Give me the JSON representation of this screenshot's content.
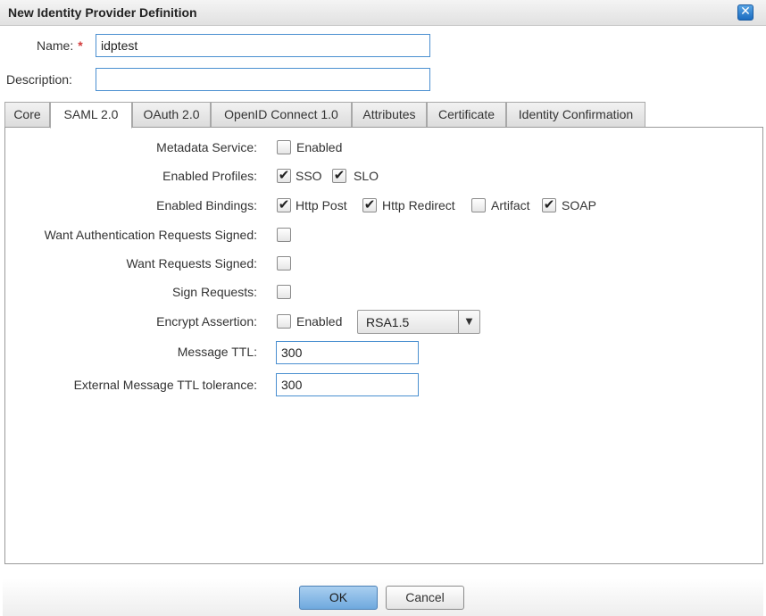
{
  "dialog": {
    "title": "New Identity Provider Definition",
    "close_glyph": "✕"
  },
  "form": {
    "name_label": "Name:",
    "name_required": "*",
    "name_value": "idptest",
    "description_label": "Description:",
    "description_value": ""
  },
  "tabs": [
    {
      "label": "Core",
      "active": false
    },
    {
      "label": "SAML 2.0",
      "active": true
    },
    {
      "label": "OAuth 2.0",
      "active": false
    },
    {
      "label": "OpenID Connect 1.0",
      "active": false
    },
    {
      "label": "Attributes",
      "active": false
    },
    {
      "label": "Certificate",
      "active": false
    },
    {
      "label": "Identity Confirmation",
      "active": false
    }
  ],
  "saml": {
    "metadata_service": {
      "label": "Metadata Service:",
      "option": "Enabled",
      "checked": false
    },
    "enabled_profiles": {
      "label": "Enabled Profiles:",
      "sso": "SSO",
      "sso_checked": true,
      "slo": "SLO",
      "slo_checked": true
    },
    "enabled_bindings": {
      "label": "Enabled Bindings:",
      "http_post": "Http Post",
      "http_post_checked": true,
      "http_redirect": "Http Redirect",
      "http_redirect_checked": true,
      "artifact": "Artifact",
      "artifact_checked": false,
      "soap": "SOAP",
      "soap_checked": true
    },
    "want_auth_requests_signed": {
      "label": "Want Authentication Requests Signed:",
      "checked": false
    },
    "want_requests_signed": {
      "label": "Want Requests Signed:",
      "checked": false
    },
    "sign_requests": {
      "label": "Sign Requests:",
      "checked": false
    },
    "encrypt_assertion": {
      "label": "Encrypt Assertion:",
      "option": "Enabled",
      "checked": false,
      "algorithm": "RSA1.5"
    },
    "message_ttl": {
      "label": "Message TTL:",
      "value": "300"
    },
    "external_ttl_tolerance": {
      "label": "External Message TTL tolerance:",
      "value": "300"
    }
  },
  "check_glyph": "✔",
  "dropdown_arrow": "▼",
  "footer": {
    "ok_label": "OK",
    "cancel_label": "Cancel"
  },
  "colors": {
    "accent": "#4a8fd0",
    "required": "#d23b3b",
    "ok_button": "#8cbde8"
  }
}
